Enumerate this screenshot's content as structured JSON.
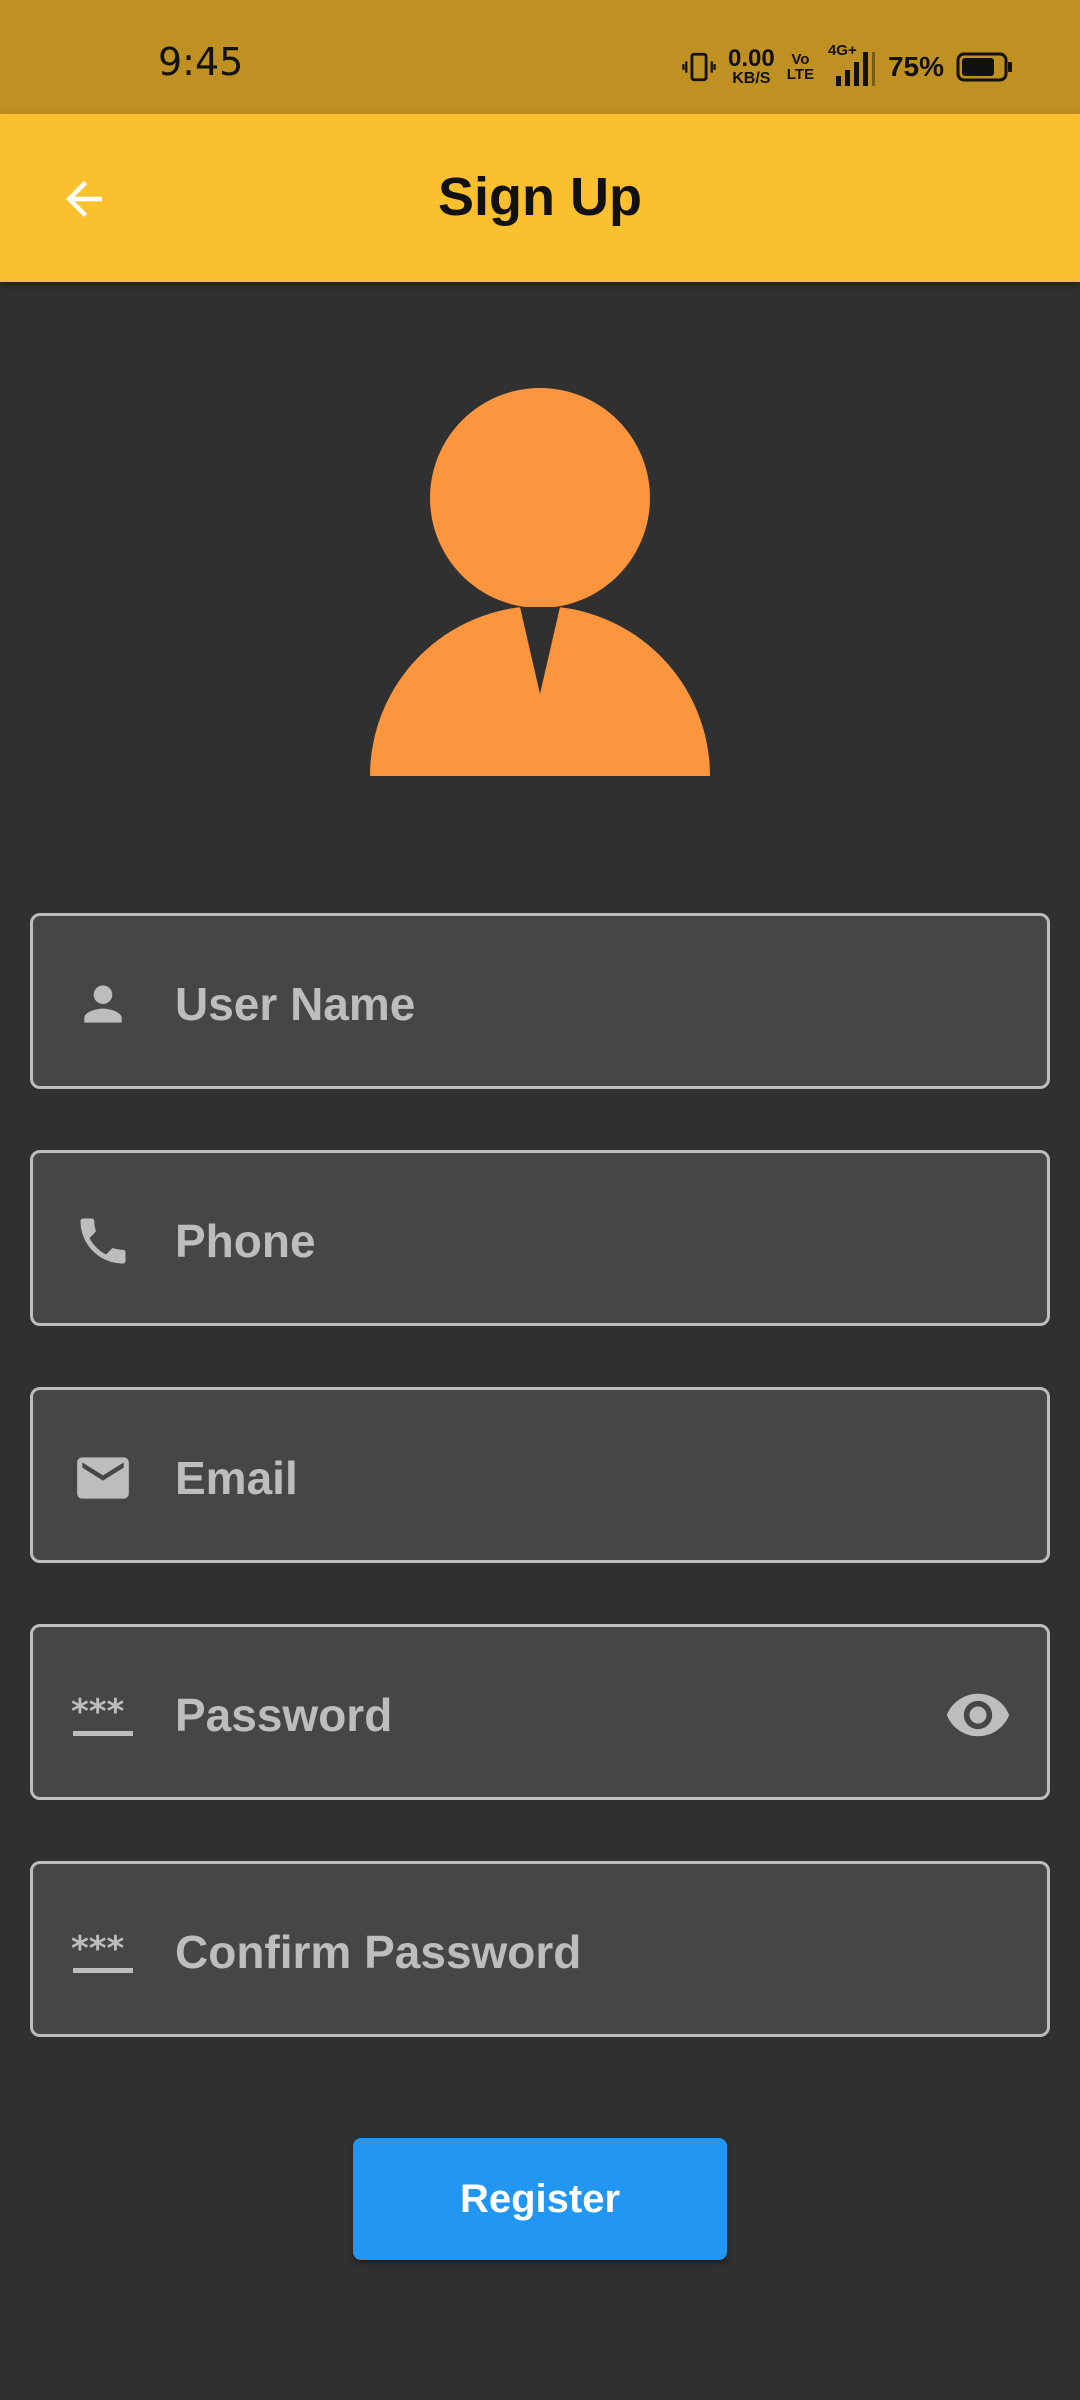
{
  "status_bar": {
    "time": "9:45",
    "net_speed_value": "0.00",
    "net_speed_unit": "KB/S",
    "volte_top": "Vo",
    "volte_bottom": "LTE",
    "network": "4G+",
    "battery": "75%",
    "battery_level": 0.75
  },
  "app_bar": {
    "title": "Sign Up",
    "back_icon": "arrow-back-icon"
  },
  "avatar": {
    "icon": "user-avatar-icon",
    "color": "#FB963F"
  },
  "form": {
    "fields": [
      {
        "label": "User Name",
        "icon": "person-icon"
      },
      {
        "label": "Phone",
        "icon": "phone-icon"
      },
      {
        "label": "Email",
        "icon": "email-icon"
      },
      {
        "label": "Password",
        "icon": "password-icon",
        "trailing_icon": "eye-icon"
      },
      {
        "label": "Confirm Password",
        "icon": "password-icon"
      }
    ],
    "register_label": "Register"
  },
  "colors": {
    "status_bar": "#BF9022",
    "app_bar": "#FBC02D",
    "background": "#303030",
    "field_bg": "#464646",
    "field_border": "#BDBDBD",
    "button": "#2196F3"
  }
}
